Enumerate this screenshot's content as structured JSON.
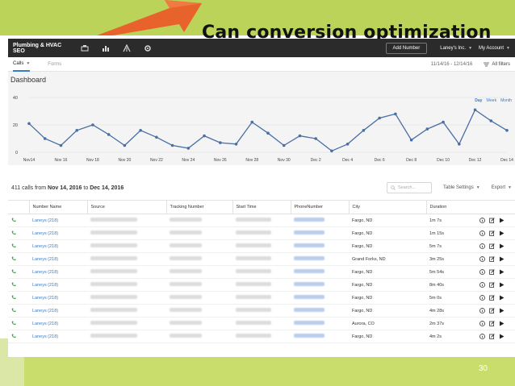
{
  "slide": {
    "title": "Can conversion optimization",
    "page_number": "30"
  },
  "app": {
    "brand": "Plumbing & HVAC SEO",
    "add_number": "Add Number",
    "company_menu": "Laney's Inc.",
    "account_menu": "My Account",
    "tabs": [
      {
        "label": "Calls",
        "active": true
      },
      {
        "label": "Forms",
        "active": false
      }
    ],
    "date_range": "11/14/16 - 12/14/16",
    "filters": "All filters"
  },
  "dashboard": {
    "title": "Dashboard",
    "range_tabs": [
      "Day",
      "Week",
      "Month"
    ]
  },
  "chart_data": {
    "type": "line",
    "x": [
      "Nov 14",
      "Nov 15",
      "Nov 16",
      "Nov 17",
      "Nov 18",
      "Nov 19",
      "Nov 20",
      "Nov 21",
      "Nov 22",
      "Nov 23",
      "Nov 24",
      "Nov 25",
      "Nov 26",
      "Nov 27",
      "Nov 28",
      "Nov 29",
      "Nov 30",
      "Dec 1",
      "Dec 2",
      "Dec 3",
      "Dec 4",
      "Dec 5",
      "Dec 6",
      "Dec 7",
      "Dec 8",
      "Dec 9",
      "Dec 10",
      "Dec 11",
      "Dec 12",
      "Dec 13",
      "Dec 14"
    ],
    "series": [
      {
        "values": [
          21,
          10,
          5,
          16,
          20,
          13,
          5,
          16,
          11,
          5,
          3,
          12,
          7,
          6,
          22,
          14,
          5,
          12,
          10,
          1,
          6,
          16,
          25,
          28,
          9,
          17,
          22,
          6,
          31,
          23,
          16
        ]
      }
    ],
    "x_tick_labels": [
      "Nov14",
      "Nov 16",
      "Nov 18",
      "Nov 20",
      "Nov 22",
      "Nov 24",
      "Nov 26",
      "Nov 28",
      "Nov 30",
      "Dec 2",
      "Dec 4",
      "Dec 6",
      "Dec 8",
      "Dec 10",
      "Dec 12",
      "Dec 14"
    ],
    "y_ticks": [
      0,
      20,
      40
    ],
    "ylim": [
      0,
      40
    ],
    "grid": true,
    "color": "#4a6fa5"
  },
  "calls": {
    "count": "411",
    "from": "Nov 14, 2016",
    "to": "Dec 14, 2016",
    "prefix": "calls from",
    "connector": "to",
    "search_placeholder": "Search...",
    "table_settings": "Table Settings",
    "export": "Export",
    "columns": [
      "Number Name",
      "Source",
      "Tracking Number",
      "Start Time",
      "PhoneNumber",
      "City",
      "Duration"
    ],
    "rows": [
      {
        "name": "Laneys (218)",
        "city": "Fargo, ND",
        "duration": "1m 7s"
      },
      {
        "name": "Laneys (218)",
        "city": "Fargo, ND",
        "duration": "1m 15s"
      },
      {
        "name": "Laneys (218)",
        "city": "Fargo, ND",
        "duration": "5m 7s"
      },
      {
        "name": "Laneys (218)",
        "city": "Grand Forks, ND",
        "duration": "3m 25s"
      },
      {
        "name": "Laneys (218)",
        "city": "Fargo, ND",
        "duration": "5m 54s"
      },
      {
        "name": "Laneys (218)",
        "city": "Fargo, ND",
        "duration": "8m 40s"
      },
      {
        "name": "Laneys (218)",
        "city": "Fargo, ND",
        "duration": "5m 0s"
      },
      {
        "name": "Laneys (218)",
        "city": "Fargo, ND",
        "duration": "4m 28s"
      },
      {
        "name": "Laneys (218)",
        "city": "Aurora, CO",
        "duration": "2m 37s"
      },
      {
        "name": "Laneys (218)",
        "city": "Fargo, ND",
        "duration": "4m 2s"
      }
    ]
  },
  "colors": {
    "accent": "#3a7bc8",
    "topbar": "#2b2b2b",
    "phone_icon": "#3aa64b",
    "slide_green": "#bcd35a",
    "arrow_orange": "#e8622c"
  }
}
